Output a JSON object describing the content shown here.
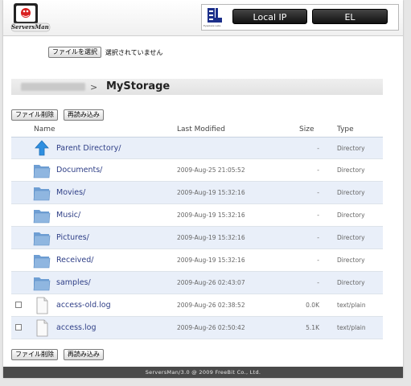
{
  "header": {
    "logo_text": "ServersMan",
    "el_logo_caption": "Eyeplaze Labs",
    "local_ip_button": "Local IP",
    "el_button": "EL"
  },
  "upload": {
    "choose_file_button": "ファイルを選択",
    "status": "選択されていません"
  },
  "breadcrumb": {
    "separator": ">",
    "current": "MyStorage"
  },
  "actions": {
    "delete_label": "ファイル削除",
    "reload_label": "再読み込み"
  },
  "table": {
    "headers": {
      "name": "Name",
      "modified": "Last Modified",
      "size": "Size",
      "type": "Type"
    },
    "rows": [
      {
        "icon": "up-arrow-icon",
        "name": "Parent Directory/",
        "modified": "",
        "size": "-",
        "type": "Directory",
        "checkbox": false
      },
      {
        "icon": "folder-icon",
        "name": "Documents/",
        "modified": "2009-Aug-25 21:05:52",
        "size": "-",
        "type": "Directory",
        "checkbox": false
      },
      {
        "icon": "folder-icon",
        "name": "Movies/",
        "modified": "2009-Aug-19 15:32:16",
        "size": "-",
        "type": "Directory",
        "checkbox": false
      },
      {
        "icon": "folder-icon",
        "name": "Music/",
        "modified": "2009-Aug-19 15:32:16",
        "size": "-",
        "type": "Directory",
        "checkbox": false
      },
      {
        "icon": "folder-icon",
        "name": "Pictures/",
        "modified": "2009-Aug-19 15:32:16",
        "size": "-",
        "type": "Directory",
        "checkbox": false
      },
      {
        "icon": "folder-icon",
        "name": "Received/",
        "modified": "2009-Aug-19 15:32:16",
        "size": "-",
        "type": "Directory",
        "checkbox": false
      },
      {
        "icon": "folder-icon",
        "name": "samples/",
        "modified": "2009-Aug-26 02:43:07",
        "size": "-",
        "type": "Directory",
        "checkbox": false
      },
      {
        "icon": "file-icon",
        "name": "access-old.log",
        "modified": "2009-Aug-26 02:38:52",
        "size": "0.0K",
        "type": "text/plain",
        "checkbox": true
      },
      {
        "icon": "file-icon",
        "name": "access.log",
        "modified": "2009-Aug-26 02:50:42",
        "size": "5.1K",
        "type": "text/plain",
        "checkbox": true
      }
    ]
  },
  "footer": {
    "text": "ServersMan/3.0 @ 2009 FreeBit Co., Ltd."
  },
  "colors": {
    "row_alt": "#e9eff9",
    "link": "#2e3e86",
    "footer_bg": "#4a4a4a",
    "folder": "#8fb6e0",
    "arrow": "#2f8fe0"
  }
}
